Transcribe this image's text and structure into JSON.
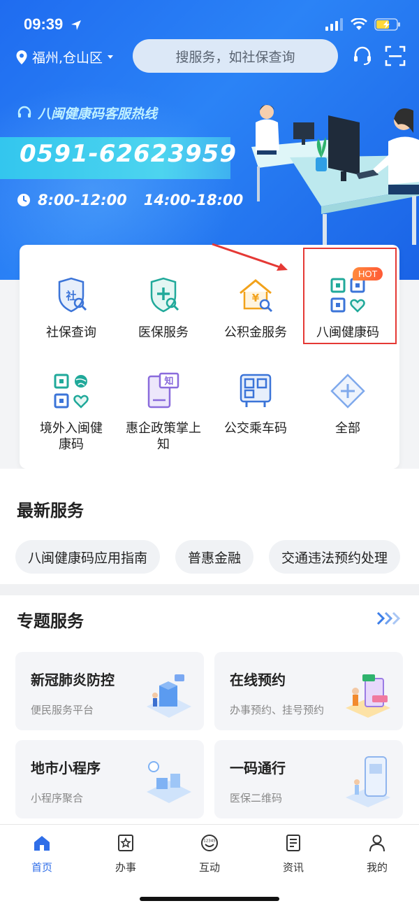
{
  "status": {
    "time": "09:39"
  },
  "header": {
    "location": "福州,仓山区",
    "search_placeholder": "搜服务，如社保查询"
  },
  "banner": {
    "hotline_title": "八闽健康码客服热线",
    "phone": "0591-62623959",
    "hours_am": "8:00-12:00",
    "hours_pm": "14:00-18:00"
  },
  "services": [
    {
      "label": "社保查询",
      "icon": "social-security-icon"
    },
    {
      "label": "医保服务",
      "icon": "medical-insurance-icon"
    },
    {
      "label": "公积金服务",
      "icon": "housing-fund-icon"
    },
    {
      "label": "八闽健康码",
      "icon": "health-code-icon",
      "badge": "HOT"
    },
    {
      "label": "境外入闽健康码",
      "icon": "overseas-health-code-icon"
    },
    {
      "label": "惠企政策掌上知",
      "icon": "policy-icon"
    },
    {
      "label": "公交乘车码",
      "icon": "bus-code-icon"
    },
    {
      "label": "全部",
      "icon": "all-services-icon"
    }
  ],
  "latest": {
    "title": "最新服务",
    "chips": [
      "八闽健康码应用指南",
      "普惠金融",
      "交通违法预约处理"
    ]
  },
  "topics": {
    "title": "专题服务",
    "cards": [
      {
        "title": "新冠肺炎防控",
        "subtitle": "便民服务平台"
      },
      {
        "title": "在线预约",
        "subtitle": "办事预约、挂号预约"
      },
      {
        "title": "地市小程序",
        "subtitle": "小程序聚合"
      },
      {
        "title": "一码通行",
        "subtitle": "医保二维码"
      }
    ]
  },
  "tabs": [
    {
      "label": "首页",
      "icon": "home-icon",
      "active": true
    },
    {
      "label": "办事",
      "icon": "star-doc-icon"
    },
    {
      "label": "互动",
      "icon": "hotline-12345-icon"
    },
    {
      "label": "资讯",
      "icon": "news-icon"
    },
    {
      "label": "我的",
      "icon": "person-icon"
    }
  ],
  "colors": {
    "brand_blue": "#2f6ee8",
    "banner_blue": "#1f6cf0",
    "hotline_cyan": "#33c6ee",
    "hot_red": "#e53935"
  }
}
